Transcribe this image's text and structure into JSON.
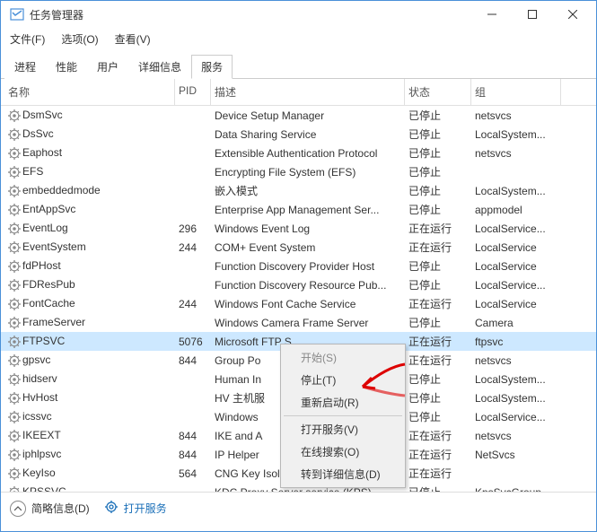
{
  "window": {
    "title": "任务管理器"
  },
  "controls": {
    "min": "—",
    "max": "☐",
    "close": "✕"
  },
  "menubar": [
    "文件(F)",
    "选项(O)",
    "查看(V)"
  ],
  "tabs": [
    "进程",
    "性能",
    "用户",
    "详细信息",
    "服务"
  ],
  "active_tab": 4,
  "columns": {
    "name": "名称",
    "pid": "PID",
    "desc": "描述",
    "status": "状态",
    "group": "组"
  },
  "services": [
    {
      "name": "DsmSvc",
      "pid": "",
      "desc": "Device Setup Manager",
      "status": "已停止",
      "group": "netsvcs"
    },
    {
      "name": "DsSvc",
      "pid": "",
      "desc": "Data Sharing Service",
      "status": "已停止",
      "group": "LocalSystem..."
    },
    {
      "name": "Eaphost",
      "pid": "",
      "desc": "Extensible Authentication Protocol",
      "status": "已停止",
      "group": "netsvcs"
    },
    {
      "name": "EFS",
      "pid": "",
      "desc": "Encrypting File System (EFS)",
      "status": "已停止",
      "group": ""
    },
    {
      "name": "embeddedmode",
      "pid": "",
      "desc": "嵌入模式",
      "status": "已停止",
      "group": "LocalSystem..."
    },
    {
      "name": "EntAppSvc",
      "pid": "",
      "desc": "Enterprise App Management Ser...",
      "status": "已停止",
      "group": "appmodel"
    },
    {
      "name": "EventLog",
      "pid": "296",
      "desc": "Windows Event Log",
      "status": "正在运行",
      "group": "LocalService..."
    },
    {
      "name": "EventSystem",
      "pid": "244",
      "desc": "COM+ Event System",
      "status": "正在运行",
      "group": "LocalService"
    },
    {
      "name": "fdPHost",
      "pid": "",
      "desc": "Function Discovery Provider Host",
      "status": "已停止",
      "group": "LocalService"
    },
    {
      "name": "FDResPub",
      "pid": "",
      "desc": "Function Discovery Resource Pub...",
      "status": "已停止",
      "group": "LocalService..."
    },
    {
      "name": "FontCache",
      "pid": "244",
      "desc": "Windows Font Cache Service",
      "status": "正在运行",
      "group": "LocalService"
    },
    {
      "name": "FrameServer",
      "pid": "",
      "desc": "Windows Camera Frame Server",
      "status": "已停止",
      "group": "Camera"
    },
    {
      "name": "FTPSVC",
      "pid": "5076",
      "desc": "Microsoft FTP S",
      "status": "正在运行",
      "group": "ftpsvc",
      "selected": true
    },
    {
      "name": "gpsvc",
      "pid": "844",
      "desc": "Group Po",
      "status": "正在运行",
      "group": "netsvcs"
    },
    {
      "name": "hidserv",
      "pid": "",
      "desc": "Human In",
      "status": "已停止",
      "group": "LocalSystem..."
    },
    {
      "name": "HvHost",
      "pid": "",
      "desc": "HV 主机服",
      "status": "已停止",
      "group": "LocalSystem..."
    },
    {
      "name": "icssvc",
      "pid": "",
      "desc": "Windows",
      "status": "已停止",
      "group": "LocalService..."
    },
    {
      "name": "IKEEXT",
      "pid": "844",
      "desc": "IKE and A",
      "status": "正在运行",
      "group": "netsvcs"
    },
    {
      "name": "iphlpsvc",
      "pid": "844",
      "desc": "IP Helper",
      "status": "正在运行",
      "group": "NetSvcs"
    },
    {
      "name": "KeyIso",
      "pid": "564",
      "desc": "CNG Key Isolation",
      "status": "正在运行",
      "group": ""
    },
    {
      "name": "KPSSVC",
      "pid": "",
      "desc": "KDC Proxy Server service (KPS)",
      "status": "已停止",
      "group": "KpsSvcGroup"
    }
  ],
  "context_menu": {
    "items": [
      {
        "label": "开始(S)",
        "disabled": true
      },
      {
        "label": "停止(T)"
      },
      {
        "label": "重新启动(R)"
      }
    ],
    "items2": [
      {
        "label": "打开服务(V)"
      },
      {
        "label": "在线搜索(O)"
      },
      {
        "label": "转到详细信息(D)"
      }
    ]
  },
  "footer": {
    "brief": "简略信息(D)",
    "open_services": "打开服务"
  }
}
